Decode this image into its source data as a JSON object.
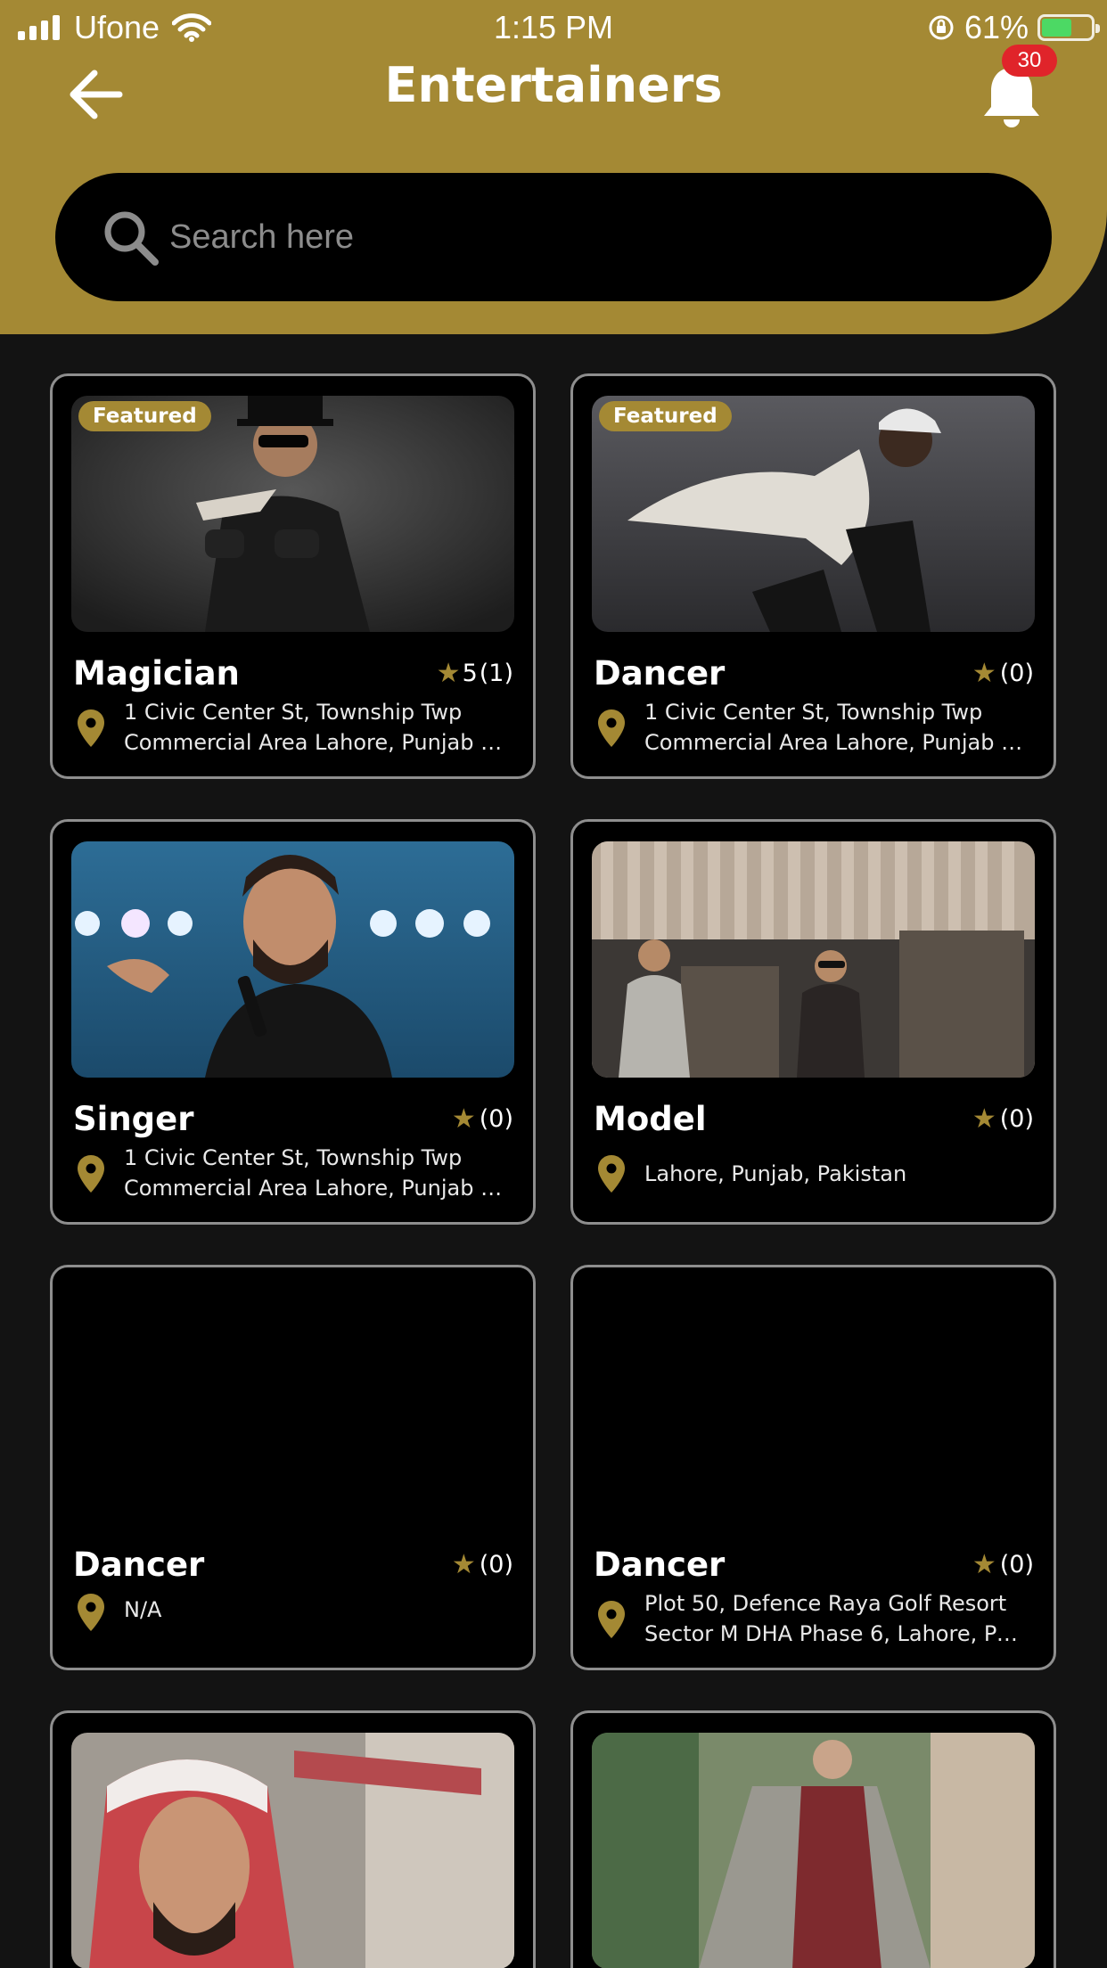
{
  "status_bar": {
    "carrier": "Ufone",
    "time": "1:15 PM",
    "battery": "61%"
  },
  "header": {
    "title": "Entertainers",
    "notification_count": "30"
  },
  "search": {
    "placeholder": "Search here"
  },
  "cards": [
    {
      "name": "Magician",
      "featured": "Featured",
      "rating": "5",
      "count": "(1)",
      "address_line1": "1 Civic Center St, Township Twp",
      "address_line2": "Commercial Area Lahore, Punjab 5..."
    },
    {
      "name": "Dancer",
      "featured": "Featured",
      "rating": "",
      "count": "(0)",
      "address_line1": "1 Civic Center St, Township Twp",
      "address_line2": "Commercial Area Lahore, Punjab 5..."
    },
    {
      "name": "Singer",
      "rating": "",
      "count": "(0)",
      "address_line1": "1 Civic Center St, Township Twp",
      "address_line2": "Commercial Area Lahore, Punjab 5..."
    },
    {
      "name": "Model",
      "rating": "",
      "count": "(0)",
      "address_line1": "Lahore, Punjab, Pakistan"
    },
    {
      "name": "Dancer",
      "rating": "",
      "count": "(0)",
      "address_line1": "N/A"
    },
    {
      "name": "Dancer",
      "rating": "",
      "count": "(0)",
      "address_line1": "Plot 50, Defence Raya Golf Resort",
      "address_line2": "Sector M DHA Phase 6, Lahore, Punj..."
    }
  ],
  "colors": {
    "accent": "#a48934",
    "background": "#131313",
    "card": "#000000",
    "badge": "#e0242a"
  },
  "icons": [
    "back-arrow-icon",
    "bell-icon",
    "search-icon",
    "star-icon",
    "location-pin-icon"
  ]
}
